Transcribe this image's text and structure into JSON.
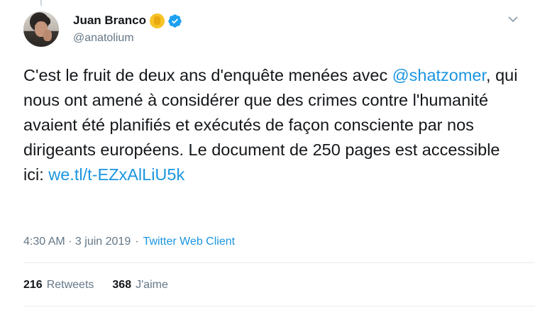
{
  "author": {
    "display_name": "Juan Branco",
    "handle": "@anatolium",
    "badge_icon": "raised-fist-emoji",
    "verified_icon": "verified-badge-icon"
  },
  "tweet": {
    "text_part1": "C'est le fruit de deux ans d'enquête menées avec ",
    "mention": "@shatzomer",
    "text_part2": ", qui nous ont amené à considérer que des crimes contre l'humanité avaient été planifiés et exécutés de façon consciente par nos dirigeants européens. Le document de 250 pages est accessible ici: ",
    "link": "we.tl/t-EZxAlLiU5k"
  },
  "meta": {
    "time": "4:30 AM · 3 juin 2019",
    "dot": "·",
    "source": "Twitter Web Client"
  },
  "stats": {
    "retweets_count": "216",
    "retweets_label": "Retweets",
    "likes_count": "368",
    "likes_label": "J'aime"
  },
  "colors": {
    "link": "#1b95e0",
    "secondary_text": "#657786",
    "divider": "#e6ecf0"
  }
}
